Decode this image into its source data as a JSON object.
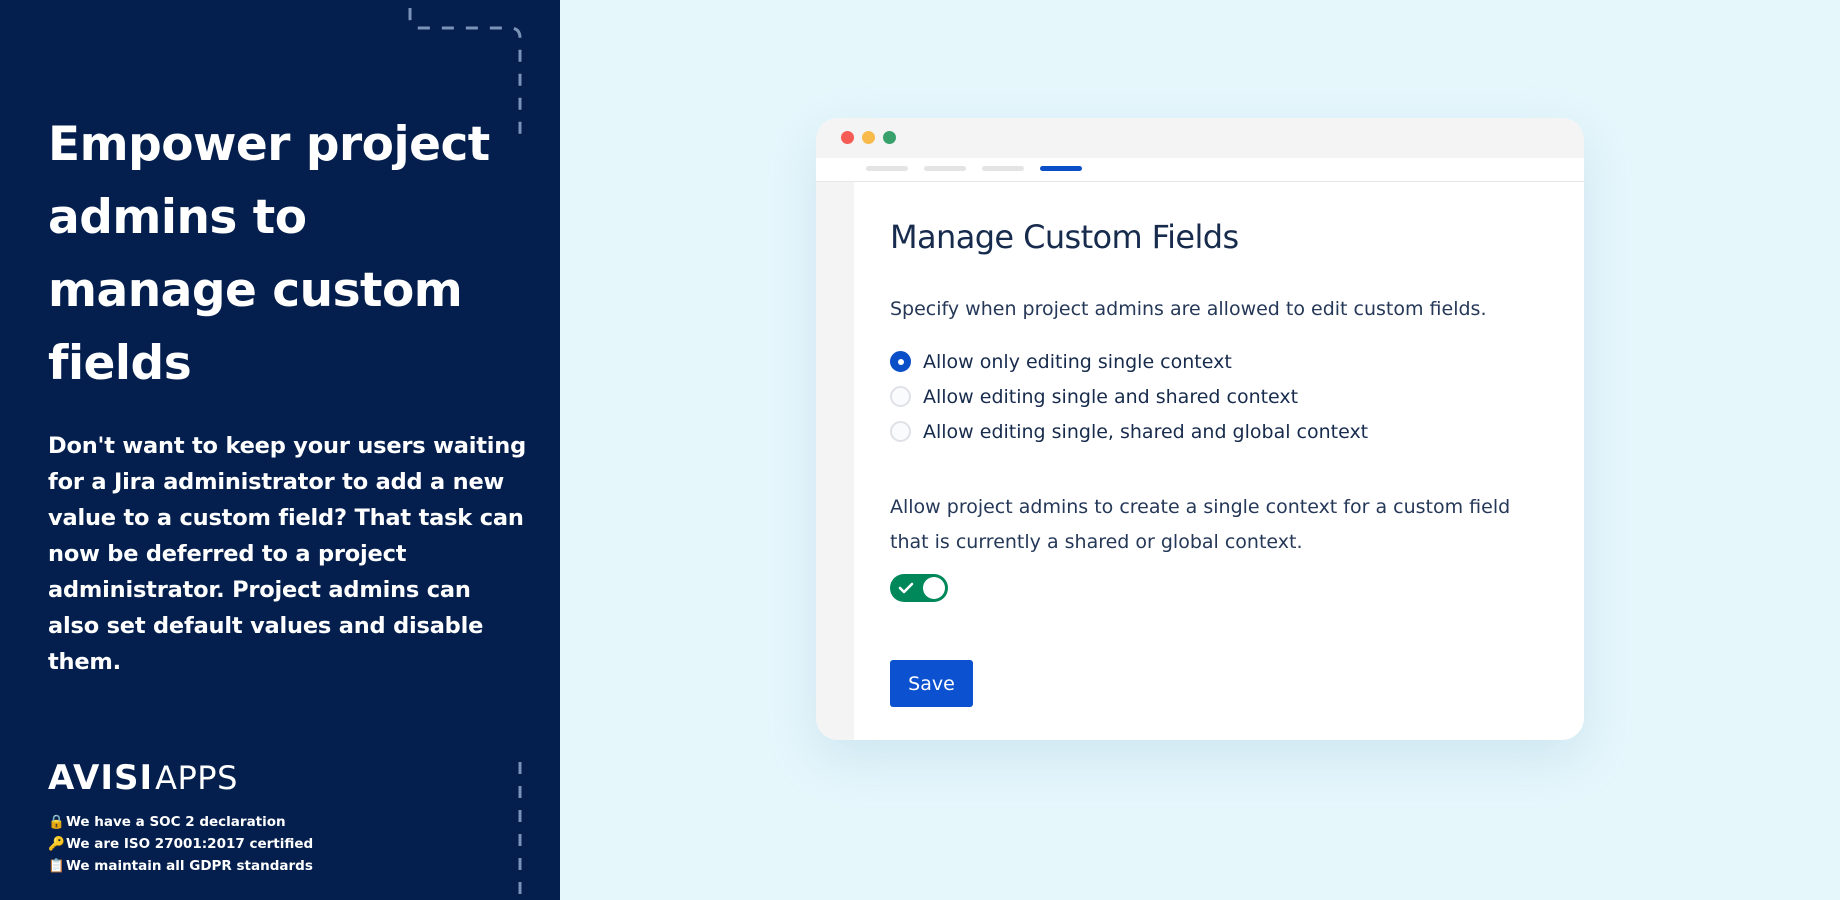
{
  "left_panel": {
    "headline": "Empower project admins to manage custom fields",
    "description": "Don't want to keep your users waiting for a Jira administrator to add a new value to a custom field? That task can now be deferred to a project administrator. Project admins can also set default values and disable them.",
    "logo": {
      "main": "AVISI",
      "sub": "APPS"
    },
    "badges": [
      {
        "icon": "lock-icon",
        "glyph": "🔒",
        "label": "We have a SOC 2 declaration"
      },
      {
        "icon": "key-icon",
        "glyph": "🔑",
        "label": "We are ISO 27001:2017 certified"
      },
      {
        "icon": "clipboard-icon",
        "glyph": "📋",
        "label": "We maintain all GDPR standards"
      }
    ]
  },
  "window": {
    "title": "Manage Custom Fields",
    "intro": "Specify when project admins are allowed to edit custom fields.",
    "options": [
      {
        "label": "Allow only editing single context",
        "checked": true
      },
      {
        "label": "Allow editing single and shared context",
        "checked": false
      },
      {
        "label": "Allow editing single, shared and global context",
        "checked": false
      }
    ],
    "toggle_description": "Allow project admins to create a single context for a custom field that is currently a shared or global context.",
    "toggle_on": true,
    "save_label": "Save"
  },
  "colors": {
    "left_bg": "#041f4d",
    "page_bg": "#e6f7fc",
    "primary": "#0b51d0",
    "toggle_on": "#00875a",
    "text": "#172b4d"
  }
}
